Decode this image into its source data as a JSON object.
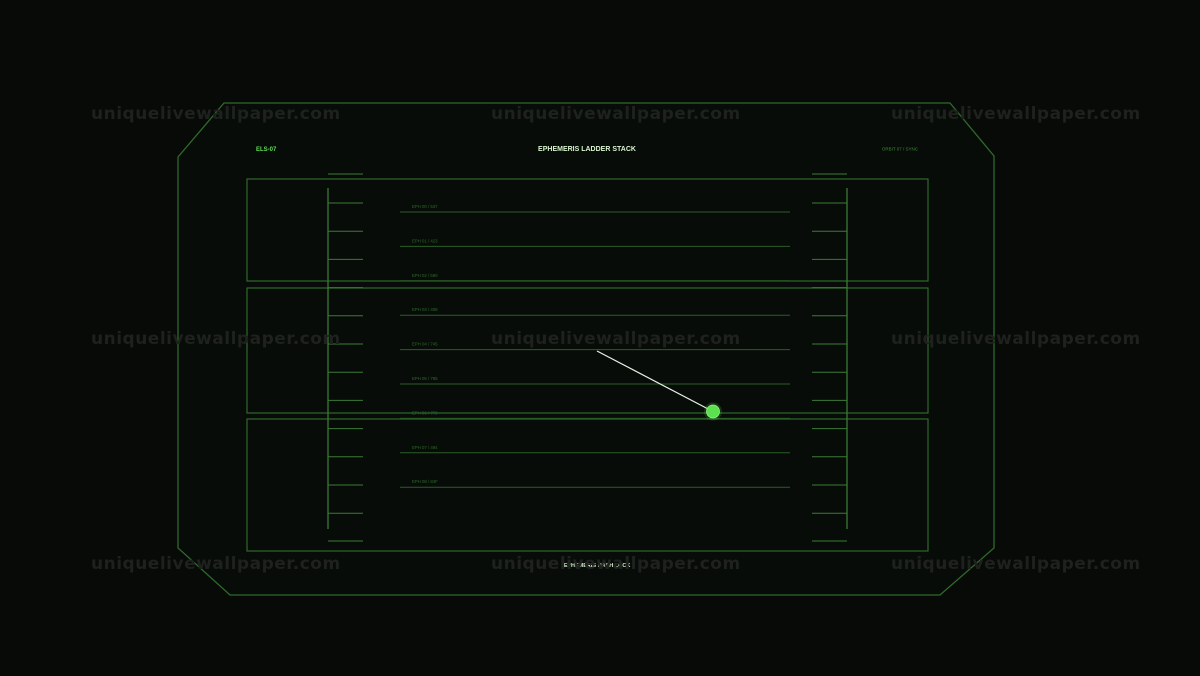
{
  "hud": {
    "left_code": "ELS-07",
    "title": "EPHEMERIS LADDER STACK",
    "right_status": "ORBIT 07 / SYNC",
    "footer_label": "EPHEMERIS HASH LOCK"
  },
  "rungs": [
    {
      "label": "EPH 00 / 537"
    },
    {
      "label": "EPH 01 / 423"
    },
    {
      "label": "EPH 02 / 590"
    },
    {
      "label": "EPH 03 / 408"
    },
    {
      "label": "EPH 04 / 745"
    },
    {
      "label": "EPH 05 / 795"
    },
    {
      "label": "EPH 06 / 779"
    },
    {
      "label": "EPH 07 / 494"
    },
    {
      "label": "EPH 08 / 84F"
    }
  ],
  "cursor": {
    "name": "locator-node"
  },
  "watermark": "uniquelivewallpaper.com",
  "colors": {
    "background": "#070a07",
    "frame_stroke": "#2f6a2c",
    "accent": "#5be04f",
    "title_text": "#d8f5d0",
    "rung_label": "#2f6a2c",
    "pointer_line": "#e8f2e4"
  }
}
